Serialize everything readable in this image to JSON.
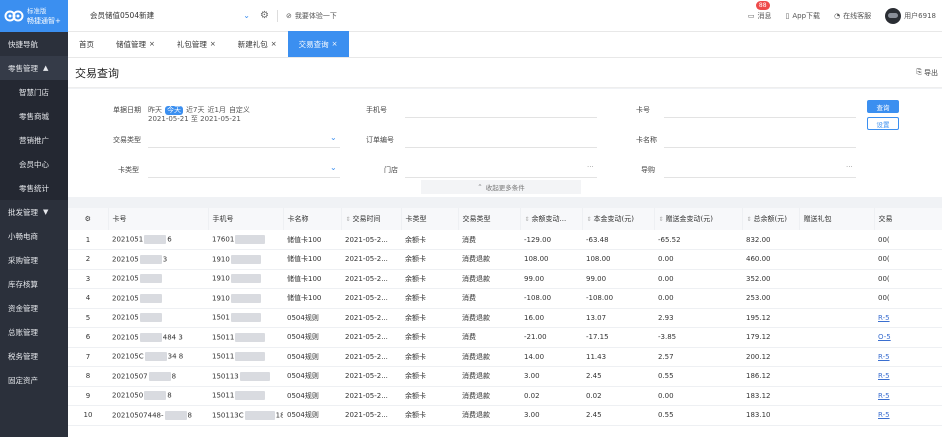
{
  "logo": {
    "title": "畅捷通智+",
    "edition": "标准版"
  },
  "sidebar": {
    "items": [
      {
        "label": "快捷导航",
        "type": "top"
      },
      {
        "label": "零售管理",
        "type": "group-open",
        "caret": "▲"
      },
      {
        "label": "智慧门店",
        "type": "sub"
      },
      {
        "label": "零售商城",
        "type": "sub"
      },
      {
        "label": "营销推广",
        "type": "sub"
      },
      {
        "label": "会员中心",
        "type": "sub"
      },
      {
        "label": "零售统计",
        "type": "sub"
      },
      {
        "label": "批发管理",
        "type": "top",
        "caret": "▼"
      },
      {
        "label": "小畅电商",
        "type": "top"
      },
      {
        "label": "采购管理",
        "type": "top"
      },
      {
        "label": "库存核算",
        "type": "top"
      },
      {
        "label": "资金管理",
        "type": "top"
      },
      {
        "label": "总账管理",
        "type": "top"
      },
      {
        "label": "税务管理",
        "type": "top"
      },
      {
        "label": "固定资产",
        "type": "top"
      }
    ]
  },
  "topbar": {
    "store": "会员储值0504新建",
    "experience": "我要体验一下",
    "messages_label": "消息",
    "messages_count": "88",
    "app_download": "App下载",
    "online_service": "在线客服",
    "user": "用户6918"
  },
  "tabs": [
    {
      "label": "首页",
      "closable": false,
      "active": false
    },
    {
      "label": "储值管理",
      "closable": true,
      "active": false
    },
    {
      "label": "礼包管理",
      "closable": true,
      "active": false
    },
    {
      "label": "新建礼包",
      "closable": true,
      "active": false
    },
    {
      "label": "交易查询",
      "closable": true,
      "active": true
    }
  ],
  "page": {
    "title": "交易查询",
    "export": "导出"
  },
  "filters": {
    "doc_date": "单据日期",
    "quick": [
      "昨天",
      "今天",
      "近7天",
      "近1月",
      "自定义"
    ],
    "date_range": "2021-05-21 至 2021-05-21",
    "phone": "手机号",
    "card_no": "卡号",
    "trade_type": "交易类型",
    "order_no": "订单编号",
    "card_name": "卡名称",
    "card_type": "卡类型",
    "store": "门店",
    "guide": "导购",
    "query_btn": "查询",
    "setting_btn": "设置",
    "collapse": "收起更多条件"
  },
  "table": {
    "columns": [
      "",
      "卡号",
      "手机号",
      "卡名称",
      "交易时间",
      "卡类型",
      "交易类型",
      "余额变动...",
      "本金变动(元)",
      "赠送金变动(元)",
      "总余额(元)",
      "赠送礼包",
      "交易"
    ],
    "rows": [
      {
        "idx": "1",
        "card_a": "2021051",
        "card_b": "6",
        "phone_a": "17601",
        "phone_b": "",
        "name": "储值卡100",
        "time": "2021-05-2...",
        "ctype": "余额卡",
        "ttype": "消费",
        "bal": "-129.00",
        "principal": "-63.48",
        "gift": "-65.52",
        "total": "832.00",
        "pkg": "",
        "trade": "00("
      },
      {
        "idx": "2",
        "card_a": "202105",
        "card_b": "3",
        "phone_a": "1910",
        "phone_b": "",
        "name": "储值卡100",
        "time": "2021-05-2...",
        "ctype": "余额卡",
        "ttype": "消费退款",
        "bal": "108.00",
        "principal": "108.00",
        "gift": "0.00",
        "total": "460.00",
        "pkg": "",
        "trade": "00("
      },
      {
        "idx": "3",
        "card_a": "202105",
        "card_b": "",
        "phone_a": "1910",
        "phone_b": "",
        "name": "储值卡100",
        "time": "2021-05-2...",
        "ctype": "余额卡",
        "ttype": "消费退款",
        "bal": "99.00",
        "principal": "99.00",
        "gift": "0.00",
        "total": "352.00",
        "pkg": "",
        "trade": "00("
      },
      {
        "idx": "4",
        "card_a": "202105",
        "card_b": "",
        "phone_a": "1910",
        "phone_b": "",
        "name": "储值卡100",
        "time": "2021-05-2...",
        "ctype": "余额卡",
        "ttype": "消费",
        "bal": "-108.00",
        "principal": "-108.00",
        "gift": "0.00",
        "total": "253.00",
        "pkg": "",
        "trade": "00("
      },
      {
        "idx": "5",
        "card_a": "202105",
        "card_b": "",
        "phone_a": "1501",
        "phone_b": "",
        "name": "0504规则",
        "time": "2021-05-2...",
        "ctype": "余额卡",
        "ttype": "消费退款",
        "bal": "16.00",
        "principal": "13.07",
        "gift": "2.93",
        "total": "195.12",
        "pkg": "",
        "trade": "R-5"
      },
      {
        "idx": "6",
        "card_a": "202105",
        "card_b": "484 3",
        "phone_a": "15011",
        "phone_b": "",
        "name": "0504规则",
        "time": "2021-05-2...",
        "ctype": "余额卡",
        "ttype": "消费",
        "bal": "-21.00",
        "principal": "-17.15",
        "gift": "-3.85",
        "total": "179.12",
        "pkg": "",
        "trade": "O-5"
      },
      {
        "idx": "7",
        "card_a": "202105C",
        "card_b": "34 8",
        "phone_a": "15011",
        "phone_b": "",
        "name": "0504规则",
        "time": "2021-05-2...",
        "ctype": "余额卡",
        "ttype": "消费退款",
        "bal": "14.00",
        "principal": "11.43",
        "gift": "2.57",
        "total": "200.12",
        "pkg": "",
        "trade": "R-5"
      },
      {
        "idx": "8",
        "card_a": "20210507",
        "card_b": "8",
        "phone_a": "150113",
        "phone_b": "",
        "name": "0504规则",
        "time": "2021-05-2...",
        "ctype": "余额卡",
        "ttype": "消费退款",
        "bal": "3.00",
        "principal": "2.45",
        "gift": "0.55",
        "total": "186.12",
        "pkg": "",
        "trade": "R-5"
      },
      {
        "idx": "9",
        "card_a": "2021050",
        "card_b": "8",
        "phone_a": "15011",
        "phone_b": "",
        "name": "0504规则",
        "time": "2021-05-2...",
        "ctype": "余额卡",
        "ttype": "消费退款",
        "bal": "0.02",
        "principal": "0.02",
        "gift": "0.00",
        "total": "183.12",
        "pkg": "",
        "trade": "R-5"
      },
      {
        "idx": "10",
        "card_a": "20210507448-",
        "card_b": "8",
        "phone_a": "150113C",
        "phone_b": "18",
        "name": "0504规则",
        "time": "2021-05-2...",
        "ctype": "余额卡",
        "ttype": "消费退款",
        "bal": "3.00",
        "principal": "2.45",
        "gift": "0.55",
        "total": "183.10",
        "pkg": "",
        "trade": "R-5"
      }
    ]
  },
  "colors": {
    "accent": "#3b8ff0",
    "sidebar": "#2b303b",
    "badge": "#ee4b4b"
  },
  "icons": [
    "logo-owl-icon",
    "gear-icon",
    "experience-icon",
    "message-icon",
    "app-download-icon",
    "service-icon",
    "avatar",
    "export-icon",
    "settings-gear-icon",
    "sort-icon",
    "collapse-chevron-icon"
  ]
}
